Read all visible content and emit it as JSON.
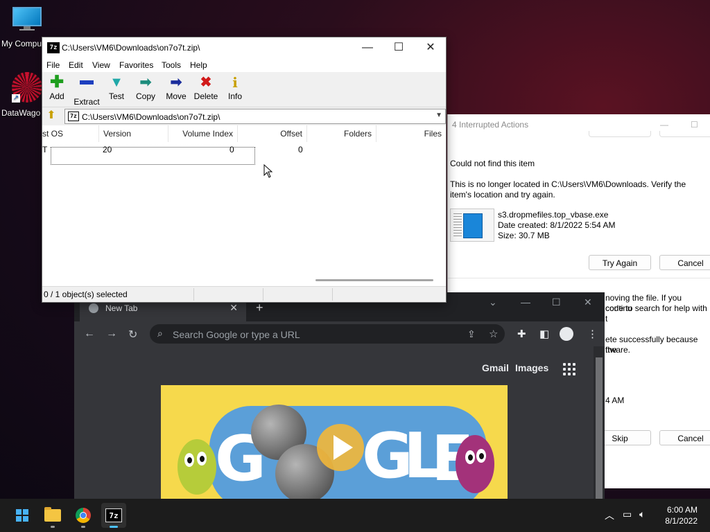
{
  "desktop": {
    "icons": [
      {
        "label": "My Compu",
        "icon": "computer-icon"
      },
      {
        "label": "DataWago",
        "icon": "datawago-icon"
      }
    ]
  },
  "dialog_interrupted": {
    "title": "4 Interrupted Actions",
    "heading": "Could not find this item",
    "message": "This is no longer located in C:\\Users\\VM6\\Downloads. Verify the item's location and try again.",
    "file": {
      "name": "s3.dropmefiles.top_vbase.exe",
      "date_created": "Date created: 8/1/2022 5:54 AM",
      "size": "Size: 30.7 MB"
    },
    "try_again_label": "Try Again",
    "cancel_label": "Cancel",
    "partial_lines": [
      "noving the file. If you continu",
      "code to search for help with t",
      "ete successfully because the",
      "ftware.",
      "4 AM"
    ],
    "skip_label": "Skip",
    "cancel2_label": "Cancel"
  },
  "sevenzip": {
    "title": "C:\\Users\\VM6\\Downloads\\on7o7t.zip\\",
    "menu": [
      "File",
      "Edit",
      "View",
      "Favorites",
      "Tools",
      "Help"
    ],
    "toolbar": [
      {
        "label": "Add",
        "icon": "plus-icon",
        "color": "#1e9e1e"
      },
      {
        "label": "Extract",
        "icon": "minus-icon",
        "color": "#1d3fbf"
      },
      {
        "label": "Test",
        "icon": "check-arrow-icon",
        "color": "#20a8a8"
      },
      {
        "label": "Copy",
        "icon": "copy-arrow-icon",
        "color": "#1c8c7c"
      },
      {
        "label": "Move",
        "icon": "move-arrow-icon",
        "color": "#1a2d9c"
      },
      {
        "label": "Delete",
        "icon": "delete-x-icon",
        "color": "#d11a1a"
      },
      {
        "label": "Info",
        "icon": "info-icon",
        "color": "#c8a000"
      }
    ],
    "address": "C:\\Users\\VM6\\Downloads\\on7o7t.zip\\",
    "columns": [
      "st OS",
      "Version",
      "Volume Index",
      "Offset",
      "Folders",
      "Files"
    ],
    "row": {
      "host_os": "T",
      "version": "20",
      "volume_index": "0",
      "offset": "0"
    },
    "status": "0 / 1 object(s) selected"
  },
  "chrome": {
    "tab_title": "New Tab",
    "omnibox_placeholder": "Search Google or type a URL",
    "links": {
      "gmail": "Gmail",
      "images": "Images"
    },
    "doodle_letters": [
      "G",
      "G",
      "L",
      "E"
    ]
  },
  "taskbar": {
    "time": "6:00 AM",
    "date": "8/1/2022",
    "accent": "#4cc2ff"
  }
}
